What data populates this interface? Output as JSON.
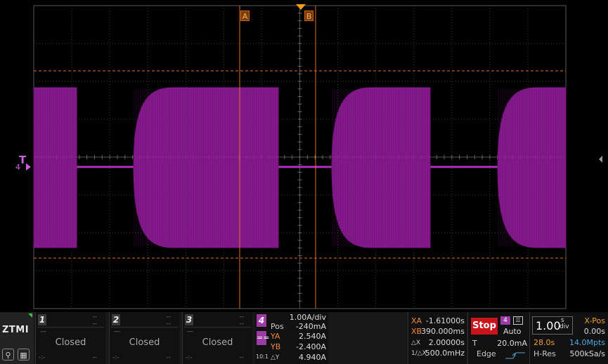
{
  "screen": {
    "cursor_a_label": "A",
    "cursor_b_label": "B",
    "trigger_label": "T",
    "trigger_channel": "4"
  },
  "colors": {
    "trace": "#9c1fa4",
    "cursor": "#e0701e",
    "grid": "#3a3a3a",
    "accent_channel4": "#9c3aa6",
    "stop": "#c8141a"
  },
  "logo": {
    "text": "ZTMI"
  },
  "channels": [
    {
      "num": "1",
      "dash_top": "--",
      "dash_mid": "--",
      "dash_bl": "-:-",
      "dash_br": "--",
      "state": "Closed"
    },
    {
      "num": "2",
      "dash_top": "--",
      "dash_mid": "--",
      "dash_bl": "-:-",
      "dash_br": "--",
      "state": "Closed"
    },
    {
      "num": "3",
      "dash_top": "--",
      "dash_mid": "--",
      "dash_bl": "-:-",
      "dash_br": "--",
      "state": "Closed"
    }
  ],
  "ch4": {
    "num": "4",
    "eq": "==",
    "ratio": "10:1",
    "scale": "1.00A/div",
    "pos_label": "Pos",
    "pos_value": "-240mA",
    "ya_label": "YA",
    "ya_value": "2.540A",
    "yb_label": "YB",
    "yb_value": "-2.400A",
    "dy_label": "△Y",
    "dy_value": "4.940A"
  },
  "cursors": {
    "xa_label": "XA",
    "xa_value": "-1.61000s",
    "xb_label": "XB",
    "xb_value": "390.000ms",
    "dx_label": "△X",
    "dx_value": "2.00000s",
    "inv_label": "1/△X",
    "inv_value": "500.0mHz"
  },
  "trigger": {
    "stop_label": "Stop",
    "channel": "4",
    "mode": "Auto",
    "level_label": "T",
    "level_value": "20.0mA",
    "type": "Edge"
  },
  "timebase": {
    "value": "1.00",
    "unit_top": "s",
    "unit_bottom": "div",
    "xpos_label": "X-Pos",
    "xpos_value": "0.00s",
    "time_span": "28.0s",
    "mem_depth": "14.0Mpts",
    "acq_mode": "H-Res",
    "sample_rate": "500kSa/s"
  }
}
